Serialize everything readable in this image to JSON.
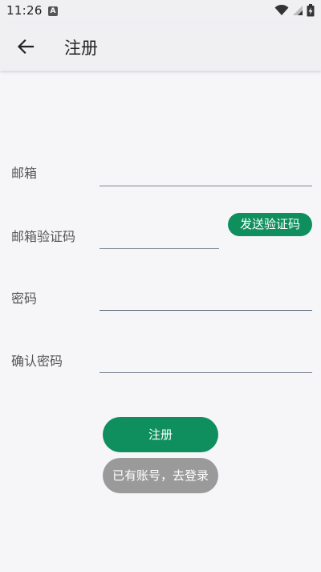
{
  "status_bar": {
    "time": "11:26",
    "notification_letter": "A",
    "icons": [
      "wifi-icon",
      "cellular-signal-icon",
      "battery-charging-icon"
    ]
  },
  "app_bar": {
    "back_icon": "arrow-left-icon",
    "title": "注册"
  },
  "form": {
    "email": {
      "label": "邮箱",
      "value": "",
      "placeholder": ""
    },
    "email_code": {
      "label": "邮箱验证码",
      "value": "",
      "placeholder": ""
    },
    "send_code_label": "发送验证码",
    "password": {
      "label": "密码",
      "value": "",
      "placeholder": ""
    },
    "confirm_password": {
      "label": "确认密码",
      "value": "",
      "placeholder": ""
    }
  },
  "actions": {
    "register_label": "注册",
    "login_link_label": "已有账号，去登录"
  },
  "colors": {
    "accent": "#0f8f5e",
    "secondary_button": "#9a9a9a",
    "background": "#f6f6f9",
    "app_bar": "#f0f0f3",
    "underline": "#7b8591"
  }
}
